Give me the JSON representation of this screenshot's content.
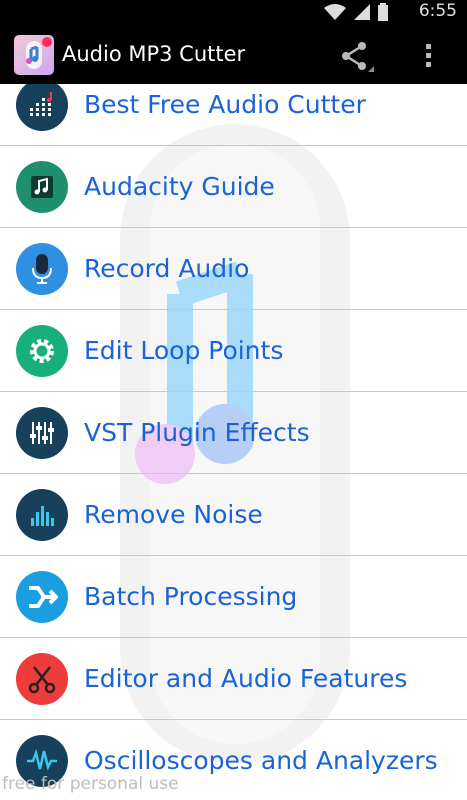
{
  "status_bar": {
    "time": "6:55"
  },
  "app": {
    "title": "Audio MP3 Cutter"
  },
  "menu": [
    {
      "label": "Best Free Audio Cutter",
      "icon": "equalizer-icon",
      "color": "#17405b"
    },
    {
      "label": "Audacity Guide",
      "icon": "music-note-icon",
      "color": "#1f8f6f"
    },
    {
      "label": "Record Audio",
      "icon": "microphone-icon",
      "color": "#2f8fe0"
    },
    {
      "label": "Edit Loop Points",
      "icon": "gear-icon",
      "color": "#17b07a"
    },
    {
      "label": "VST Plugin Effects",
      "icon": "mixer-sliders-icon",
      "color": "#17405b"
    },
    {
      "label": "Remove Noise",
      "icon": "audio-bars-icon",
      "color": "#17405b"
    },
    {
      "label": "Batch Processing",
      "icon": "merge-arrows-icon",
      "color": "#1b9ee0"
    },
    {
      "label": "Editor and Audio Features",
      "icon": "scissors-icon",
      "color": "#ee3b3b"
    },
    {
      "label": "Oscilloscopes and Analyzers",
      "icon": "waveform-icon",
      "color": "#17405b"
    }
  ],
  "watermark": "free for personal use"
}
